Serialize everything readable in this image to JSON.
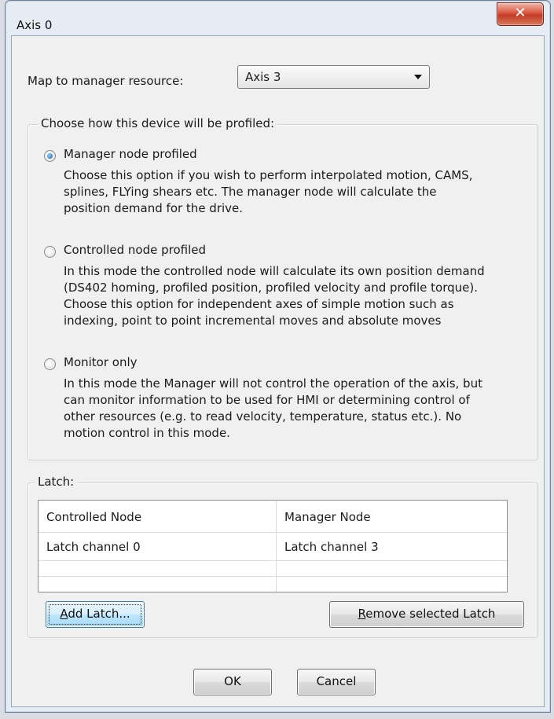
{
  "window": {
    "title": "Axis 0",
    "close_glyph": "✕"
  },
  "mapping": {
    "label": "Map to manager resource:",
    "value": "Axis 3"
  },
  "profiling": {
    "legend": "Choose how this device will be profiled:",
    "options": [
      {
        "label": "Manager node profiled",
        "selected": true,
        "desc": [
          "Choose this option if you wish to perform interpolated motion, CAMS,",
          "splines, FLYing shears etc. The manager node will calculate the",
          "position demand for the drive."
        ]
      },
      {
        "label": "Controlled node profiled",
        "selected": false,
        "desc": [
          "In this mode the controlled node will calculate its own position demand",
          "(DS402 homing, profiled position, profiled velocity and profile torque).",
          "Choose this option for independent axes of simple motion such as",
          "indexing, point to point incremental moves and absolute moves"
        ]
      },
      {
        "label": "Monitor only",
        "selected": false,
        "desc": [
          "In this mode the Manager will not control the operation of the axis, but",
          "can monitor information to be used for HMI or determining control of",
          "other resources (e.g. to read velocity, temperature, status etc.). No",
          "motion control in this mode."
        ]
      }
    ]
  },
  "latch": {
    "legend": "Latch:",
    "columns": [
      "Controlled Node",
      "Manager Node"
    ],
    "rows": [
      [
        "Latch channel 0",
        "Latch channel 3"
      ]
    ],
    "add_button": {
      "label": "Add Latch...",
      "mnemonic": "A",
      "rest": "dd Latch..."
    },
    "remove_button": {
      "label": "Remove selected Latch",
      "mnemonic": "R",
      "rest": "emove selected Latch"
    }
  },
  "footer": {
    "ok_label": "OK",
    "cancel_label": "Cancel"
  },
  "colors": {
    "accent": "#3c7fb1",
    "close": "#c23b26",
    "window_frame": "#e6ecf3"
  }
}
